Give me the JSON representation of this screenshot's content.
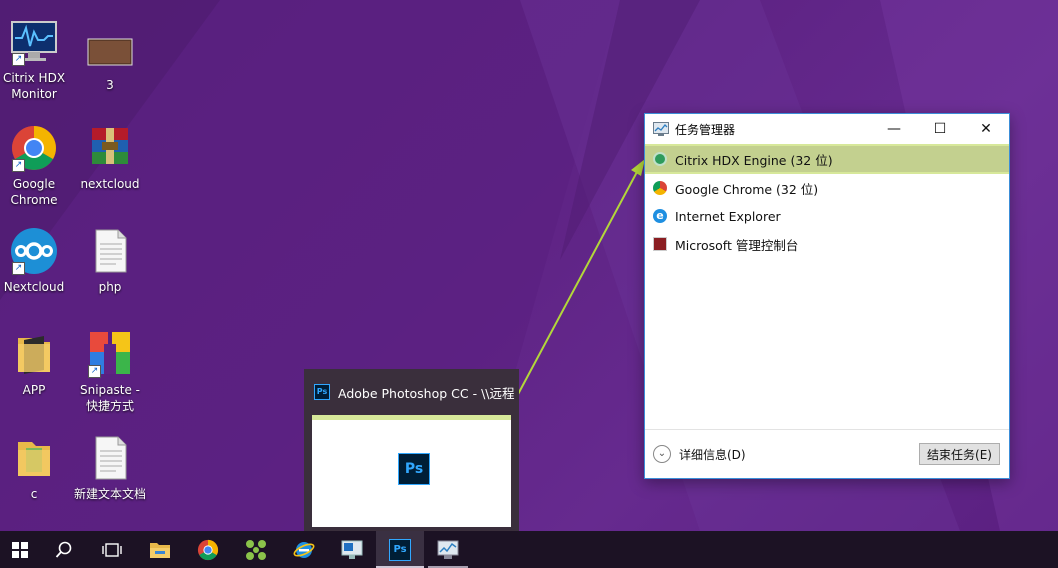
{
  "desktop": {
    "icons": [
      {
        "label": "Citrix HDX\nMonitor"
      },
      {
        "label": "3"
      },
      {
        "label": "Google\nChrome"
      },
      {
        "label": "nextcloud"
      },
      {
        "label": "Nextcloud"
      },
      {
        "label": "php"
      },
      {
        "label": "APP"
      },
      {
        "label": "Snipaste -\n快捷方式"
      },
      {
        "label": "c"
      },
      {
        "label": "新建文本文档"
      }
    ]
  },
  "task_manager": {
    "title": "任务管理器",
    "minimize": "—",
    "maximize": "☐",
    "close": "✕",
    "processes": [
      {
        "name": "Citrix HDX Engine (32 位)",
        "selected": true
      },
      {
        "name": "Google Chrome (32 位)"
      },
      {
        "name": "Internet Explorer"
      },
      {
        "name": "Microsoft 管理控制台"
      }
    ],
    "more_details": "详细信息(D)",
    "end_task": "结束任务(E)"
  },
  "thumbnail": {
    "title": "Adobe Photoshop CC - \\\\远程",
    "ps_icon": "Ps"
  },
  "taskbar": {
    "items": [
      "start-icon",
      "search-icon",
      "task-view-icon",
      "file-explorer-icon",
      "chrome-icon",
      "citrix-icon",
      "ie-icon",
      "remote-desktop-icon",
      "photoshop-icon",
      "task-manager-icon"
    ],
    "ps_label": "Ps"
  },
  "colors": {
    "accent": "#c3d08f",
    "arrow": "#b3d73a",
    "desktop": "#5e2384",
    "taskbar": "#1c1224"
  }
}
